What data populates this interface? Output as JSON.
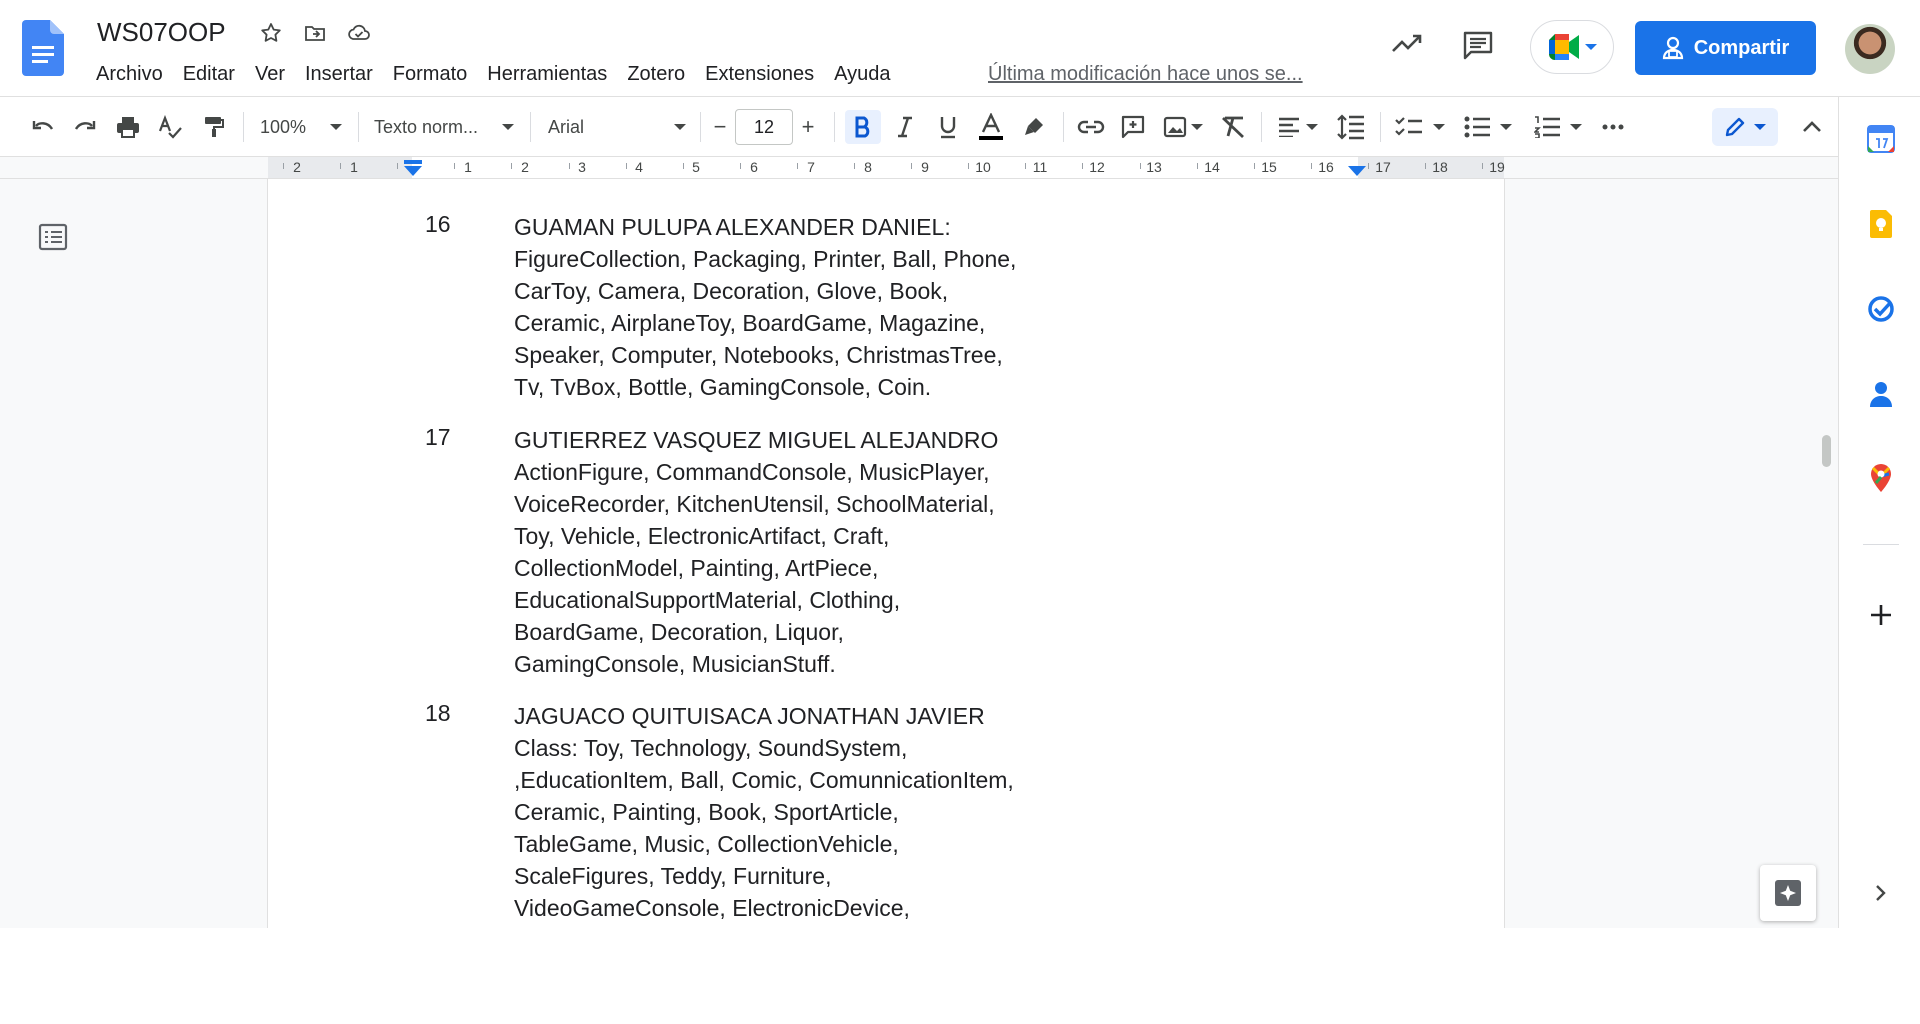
{
  "header": {
    "doc_title": "WS07OOP",
    "menu": [
      "Archivo",
      "Editar",
      "Ver",
      "Insertar",
      "Formato",
      "Herramientas",
      "Zotero",
      "Extensiones",
      "Ayuda"
    ],
    "last_modified": "Última modificación hace unos se...",
    "share_label": "Compartir"
  },
  "toolbar": {
    "zoom": "100%",
    "style": "Texto norm...",
    "font": "Arial",
    "font_size": "12",
    "minus": "−",
    "plus": "+"
  },
  "ruler": {
    "labels": [
      "2",
      "1",
      "1",
      "2",
      "3",
      "4",
      "5",
      "6",
      "7",
      "8",
      "9",
      "10",
      "11",
      "12",
      "13",
      "14",
      "15",
      "16",
      "17",
      "18",
      "19"
    ]
  },
  "entries": [
    {
      "number": "16",
      "lines": [
        "GUAMAN PULUPA ALEXANDER DANIEL:",
        "FigureCollection, Packaging, Printer, Ball, Phone,",
        "CarToy, Camera, Decoration, Glove, Book,",
        "Ceramic, AirplaneToy, BoardGame, Magazine,",
        "Speaker, Computer, Notebooks, ChristmasTree,",
        "Tv, TvBox, Bottle, GamingConsole, Coin."
      ]
    },
    {
      "number": "17",
      "lines": [
        "GUTIERREZ VASQUEZ MIGUEL ALEJANDRO",
        "ActionFigure, CommandConsole, MusicPlayer,",
        "VoiceRecorder, KitchenUtensil, SchoolMaterial,",
        "Toy, Vehicle, ElectronicArtifact, Craft,",
        "CollectionModel, Painting, ArtPiece,",
        "EducationalSupportMaterial, Clothing,",
        "BoardGame, Decoration, Liquor,",
        "GamingConsole, MusicianStuff."
      ]
    },
    {
      "number": "18",
      "lines": [
        "JAGUACO QUITUISACA JONATHAN JAVIER",
        "Class: Toy, Technology, SoundSystem,",
        ",EducationItem, Ball, Comic, ComunnicationItem,",
        "Ceramic, Painting, Book, SportArticle,",
        "TableGame, Music, CollectionVehicle,",
        "ScaleFigures, Teddy, Furniture,",
        "VideoGameConsole, ElectronicDevice,"
      ]
    }
  ],
  "colors": {
    "accent": "#1a73e8",
    "docs_blue": "#4285f4"
  }
}
